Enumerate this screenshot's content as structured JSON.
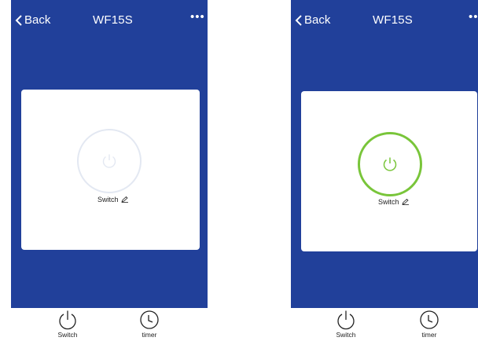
{
  "screens": [
    {
      "state": "off",
      "nav": {
        "back_label": "Back",
        "title": "WF15S",
        "more_label": "•••"
      },
      "device": {
        "switch_label": "Switch",
        "power_ring_color": "#e3e8f2",
        "power_icon_color": "#e3e8f2"
      },
      "tabs": [
        {
          "label": "Switch",
          "icon": "power-icon"
        },
        {
          "label": "timer",
          "icon": "clock-icon"
        }
      ]
    },
    {
      "state": "on",
      "nav": {
        "back_label": "Back",
        "title": "WF15S",
        "more_label": "••"
      },
      "device": {
        "switch_label": "Switch",
        "power_ring_color": "#79c53a",
        "power_icon_color": "#79c53a"
      },
      "tabs": [
        {
          "label": "Switch",
          "icon": "power-icon"
        },
        {
          "label": "timer",
          "icon": "clock-icon"
        }
      ]
    }
  ],
  "colors": {
    "header_bg": "#21409a",
    "card_bg": "#ffffff",
    "accent_on": "#79c53a"
  }
}
